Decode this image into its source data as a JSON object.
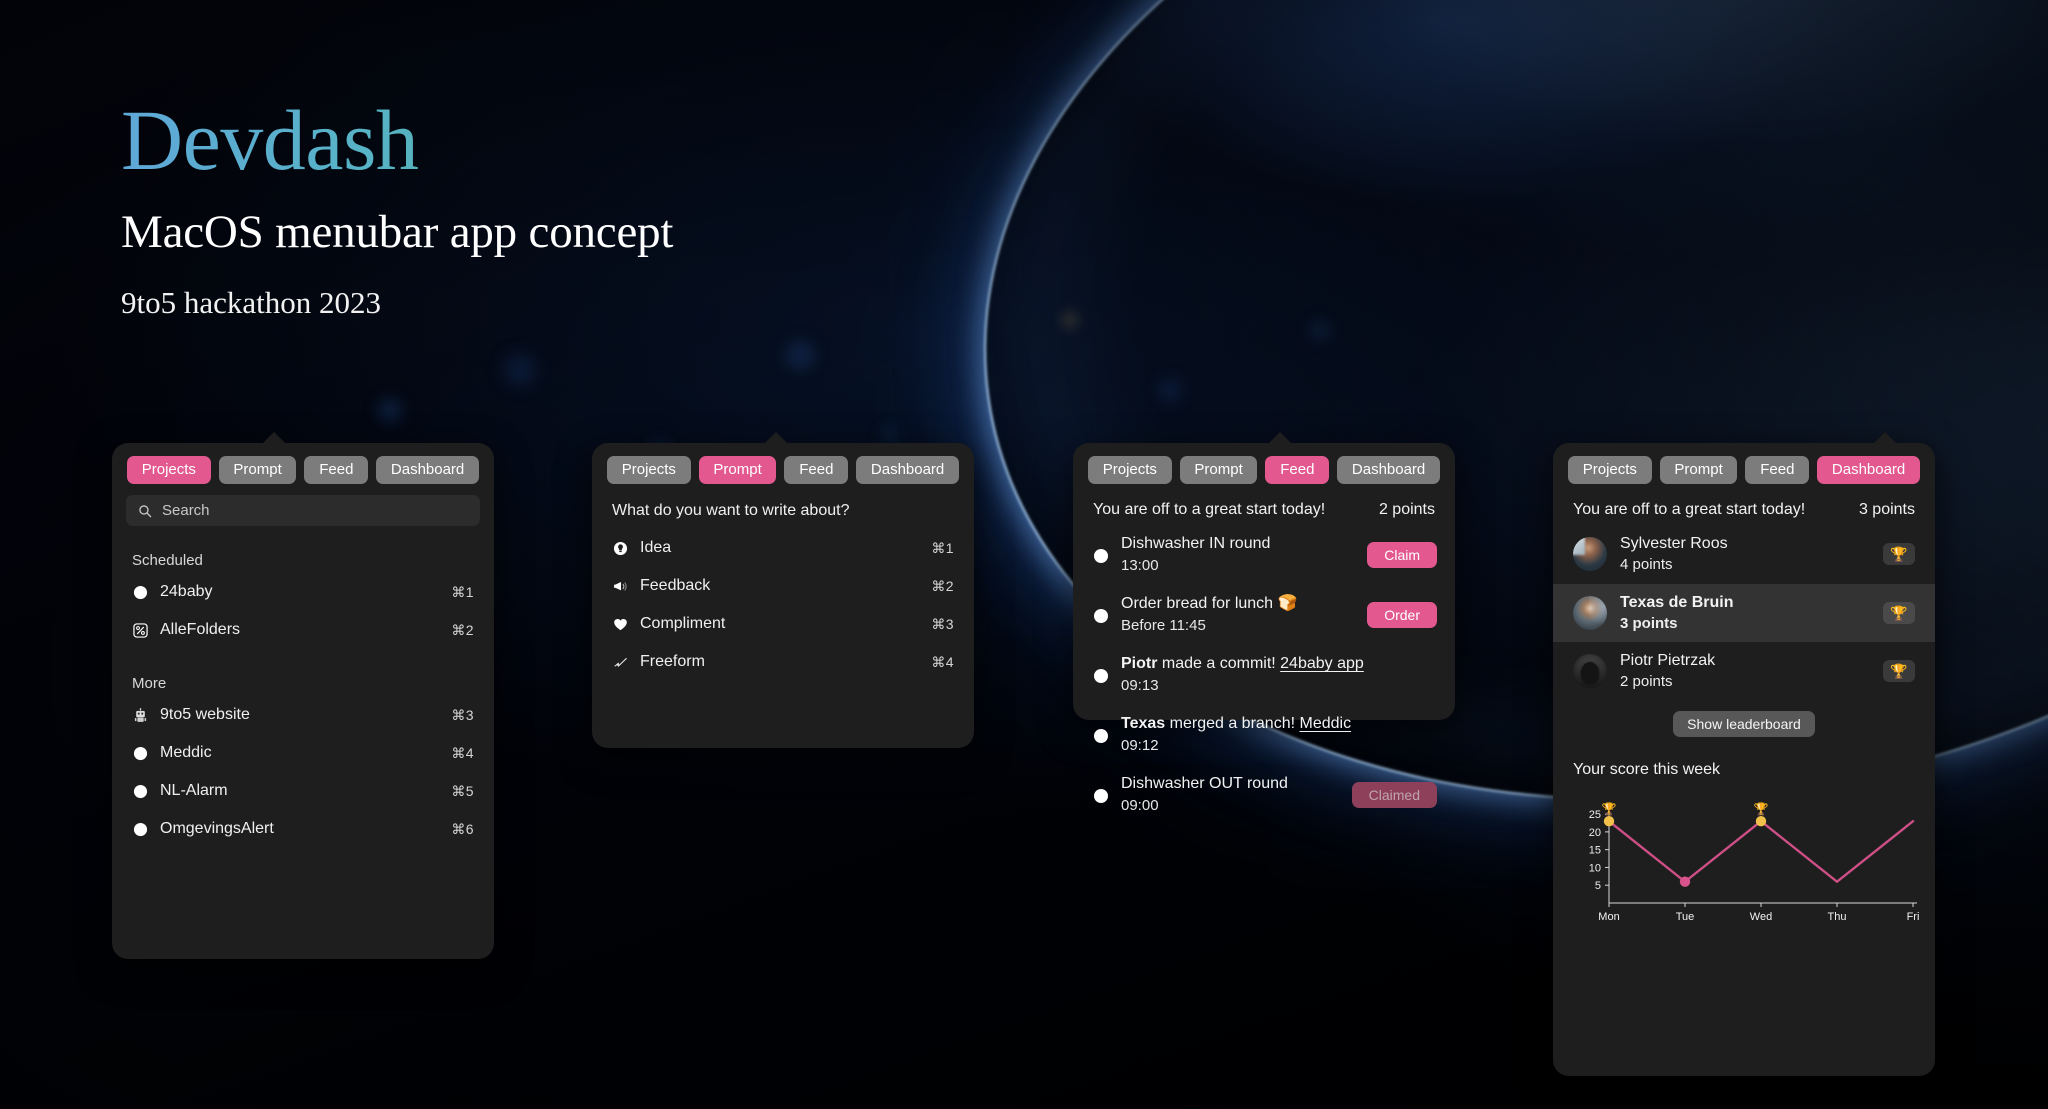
{
  "hero": {
    "title": "Devdash",
    "subtitle": "MacOS menubar app concept",
    "event": "9to5 hackathon 2023",
    "title_gradient_from": "#5fa8d8",
    "title_gradient_to": "#4fae8e"
  },
  "theme": {
    "accent": "#e2588f",
    "panel_bg": "#1e1e1e",
    "tab_bg": "#7c7c7c",
    "text": "#f2f2f2"
  },
  "tabs": [
    "Projects",
    "Prompt",
    "Feed",
    "Dashboard"
  ],
  "panels": {
    "projects": {
      "active_tab": "Projects",
      "search": {
        "placeholder": "Search",
        "value": "",
        "icon": "search-icon"
      },
      "sections": [
        {
          "label": "Scheduled",
          "items": [
            {
              "icon": "moon-phase-icon",
              "label": "24baby",
              "shortcut": "⌘1"
            },
            {
              "icon": "percent-box-icon",
              "label": "AlleFolders",
              "shortcut": "⌘2"
            }
          ]
        },
        {
          "label": "More",
          "items": [
            {
              "icon": "robot-icon",
              "label": "9to5 website",
              "shortcut": "⌘3"
            },
            {
              "icon": "circle-icon",
              "label": "Meddic",
              "shortcut": "⌘4"
            },
            {
              "icon": "circle-icon",
              "label": "NL-Alarm",
              "shortcut": "⌘5"
            },
            {
              "icon": "circle-icon",
              "label": "OmgevingsAlert",
              "shortcut": "⌘6"
            }
          ]
        }
      ]
    },
    "prompt": {
      "active_tab": "Prompt",
      "question": "What do you want to write about?",
      "items": [
        {
          "icon": "lightbulb-icon",
          "label": "Idea",
          "shortcut": "⌘1"
        },
        {
          "icon": "megaphone-icon",
          "label": "Feedback",
          "shortcut": "⌘2"
        },
        {
          "icon": "heart-icon",
          "label": "Compliment",
          "shortcut": "⌘3"
        },
        {
          "icon": "pen-scribble-icon",
          "label": "Freeform",
          "shortcut": "⌘4"
        }
      ]
    },
    "feed": {
      "active_tab": "Feed",
      "greeting": "You are off to a great start today!",
      "points": "2 points",
      "items": [
        {
          "icon": "moon-phase-icon",
          "title_plain": "Dishwasher IN round",
          "time": "13:00",
          "action": {
            "label": "Claim",
            "state": "active"
          }
        },
        {
          "icon": "moon-phase-icon",
          "title_plain": "Order bread for lunch 🍞",
          "time": "Before 11:45",
          "action": {
            "label": "Order",
            "state": "active"
          }
        },
        {
          "icon": "moon-phase-icon",
          "title_bold": "Piotr",
          "title_mid": " made a commit! ",
          "title_link": "24baby app",
          "time": "09:13",
          "action": null
        },
        {
          "icon": "moon-phase-icon",
          "title_bold": "Texas",
          "title_mid": " merged a branch! ",
          "title_link": "Meddic",
          "time": "09:12",
          "action": null
        },
        {
          "icon": "moon-phase-icon",
          "title_plain": "Dishwasher OUT round",
          "time": "09:00",
          "action": {
            "label": "Claimed",
            "state": "done"
          }
        }
      ]
    },
    "dashboard": {
      "active_tab": "Dashboard",
      "greeting": "You are off to a great start today!",
      "points": "3 points",
      "leaderboard": [
        {
          "name": "Sylvester Roos",
          "points": "4 points",
          "trophy": "🏆",
          "highlight": false,
          "avatar": "av1"
        },
        {
          "name": "Texas de Bruin",
          "points": "3 points",
          "trophy": "🏆",
          "highlight": true,
          "avatar": "av2"
        },
        {
          "name": "Piotr Pietrzak",
          "points": "2 points",
          "trophy": "🏆",
          "highlight": false,
          "avatar": "av3"
        }
      ],
      "show_leaderboard_label": "Show leaderboard",
      "chart_title": "Your score this week"
    }
  },
  "chart_data": {
    "type": "line",
    "title": "Your score this week",
    "categories": [
      "Mon",
      "Tue",
      "Wed",
      "Thu",
      "Fri"
    ],
    "values": [
      23,
      6,
      23,
      6,
      23
    ],
    "y_ticks": [
      5,
      10,
      15,
      20,
      25
    ],
    "ylim": [
      0,
      27
    ],
    "xlabel": "",
    "ylabel": "",
    "grid": false,
    "legend": false,
    "line_color": "#cc4f86",
    "markers": [
      {
        "x": "Mon",
        "y": 23,
        "color": "#f2c14a",
        "annotation": "🏆"
      },
      {
        "x": "Tue",
        "y": 6,
        "color": "#d9538c",
        "annotation": ""
      },
      {
        "x": "Wed",
        "y": 23,
        "color": "#f2c14a",
        "annotation": "🏆"
      }
    ]
  }
}
